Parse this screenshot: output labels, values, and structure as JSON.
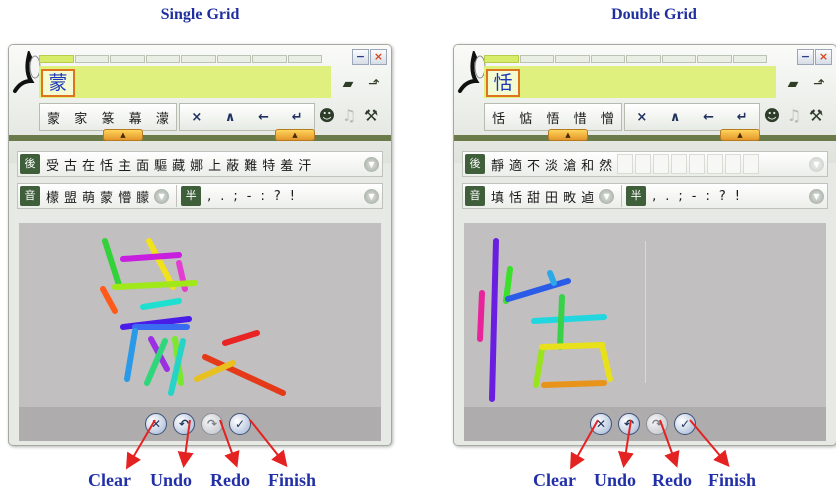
{
  "headings": {
    "single": "Single Grid",
    "double": "Double Grid"
  },
  "window": {
    "minimize_label": "−",
    "close_label": "×"
  },
  "left": {
    "composing_char": "蒙",
    "candidates": [
      "蒙",
      "家",
      "篆",
      "幕",
      "濛"
    ],
    "row1_label": "後",
    "row1_chars": [
      "受",
      "古",
      "在",
      "恬",
      "主",
      "面",
      "驅",
      "藏",
      "娜",
      "上",
      "蔽",
      "難",
      "特",
      "羞",
      "汗"
    ],
    "row2_label": "音",
    "row2_chars": [
      "檬",
      "盟",
      "萌",
      "蒙",
      "懵",
      "朦"
    ],
    "half_label": "半",
    "punctuation": [
      ",",
      ".",
      ";",
      "-",
      ":",
      "?",
      "!"
    ]
  },
  "right": {
    "composing_char": "恬",
    "candidates": [
      "恬",
      "惦",
      "悟",
      "惜",
      "憎"
    ],
    "row1_label": "後",
    "row1_chars": [
      "靜",
      "適",
      "不",
      "淡",
      "滄",
      "和",
      "然"
    ],
    "row2_label": "音",
    "row2_chars": [
      "填",
      "恬",
      "甜",
      "田",
      "畋",
      "逌"
    ],
    "half_label": "半",
    "punctuation": [
      ",",
      ".",
      ";",
      "-",
      ":",
      "?",
      "!"
    ]
  },
  "nav_icons": [
    "×",
    "∧",
    "←",
    "↵"
  ],
  "controls": {
    "clear": "Clear",
    "undo": "Undo",
    "redo": "Redo",
    "finish": "Finish",
    "clear_glyph": "✕",
    "undo_glyph": "↶",
    "redo_glyph": "↷",
    "finish_glyph": "✓"
  },
  "colors": {
    "heading": "#1f2fa0",
    "arrow": "#e52222",
    "highlight": "#dff07f",
    "accent": "#e0731e"
  }
}
